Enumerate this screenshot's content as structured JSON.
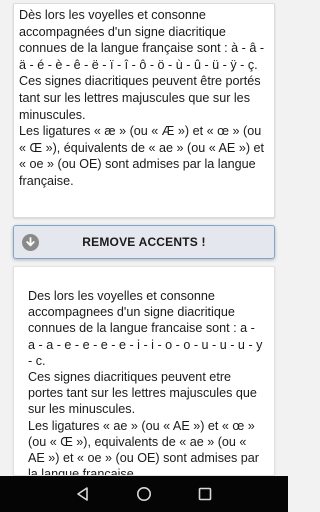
{
  "input": {
    "text": "Dès lors les voyelles et consonne accompagnées d'un signe diacritique connues de la langue française sont : à - â - ä - é - è - ê - ë - ï - î - ô - ö - ù - û - ü - ÿ - ç.\nCes signes diacritiques peuvent être portés tant sur les lettres majuscules que sur les minuscules.\nLes ligatures « æ » (ou « Æ ») et « œ » (ou « Œ »), équivalents de « ae » (ou « AE ») et « oe » (ou OE) sont admises par la langue française."
  },
  "action_button": {
    "label": "REMOVE ACCENTS !",
    "icon": "download-circle-icon"
  },
  "output": {
    "text": "Des lors les voyelles et consonne accompagnees d'un signe diacritique connues de la langue francaise sont : a - a - a - e - e - e - e - i - i - o - o - u - u - u - y - c.\nCes signes diacritiques peuvent etre portes tant sur les lettres majuscules que sur les minuscules.\nLes ligatures « ae » (ou « AE ») et « œ » (ou « Œ »), equivalents de « ae » (ou « AE ») et « oe » (ou OE) sont admises par la langue francaise."
  },
  "navbar": {
    "icons": [
      "back-icon",
      "home-icon",
      "recents-icon"
    ]
  },
  "colors": {
    "button_bg": "#e4e8ee",
    "button_border": "#7fa6cf",
    "navbar_bg": "#050505"
  }
}
